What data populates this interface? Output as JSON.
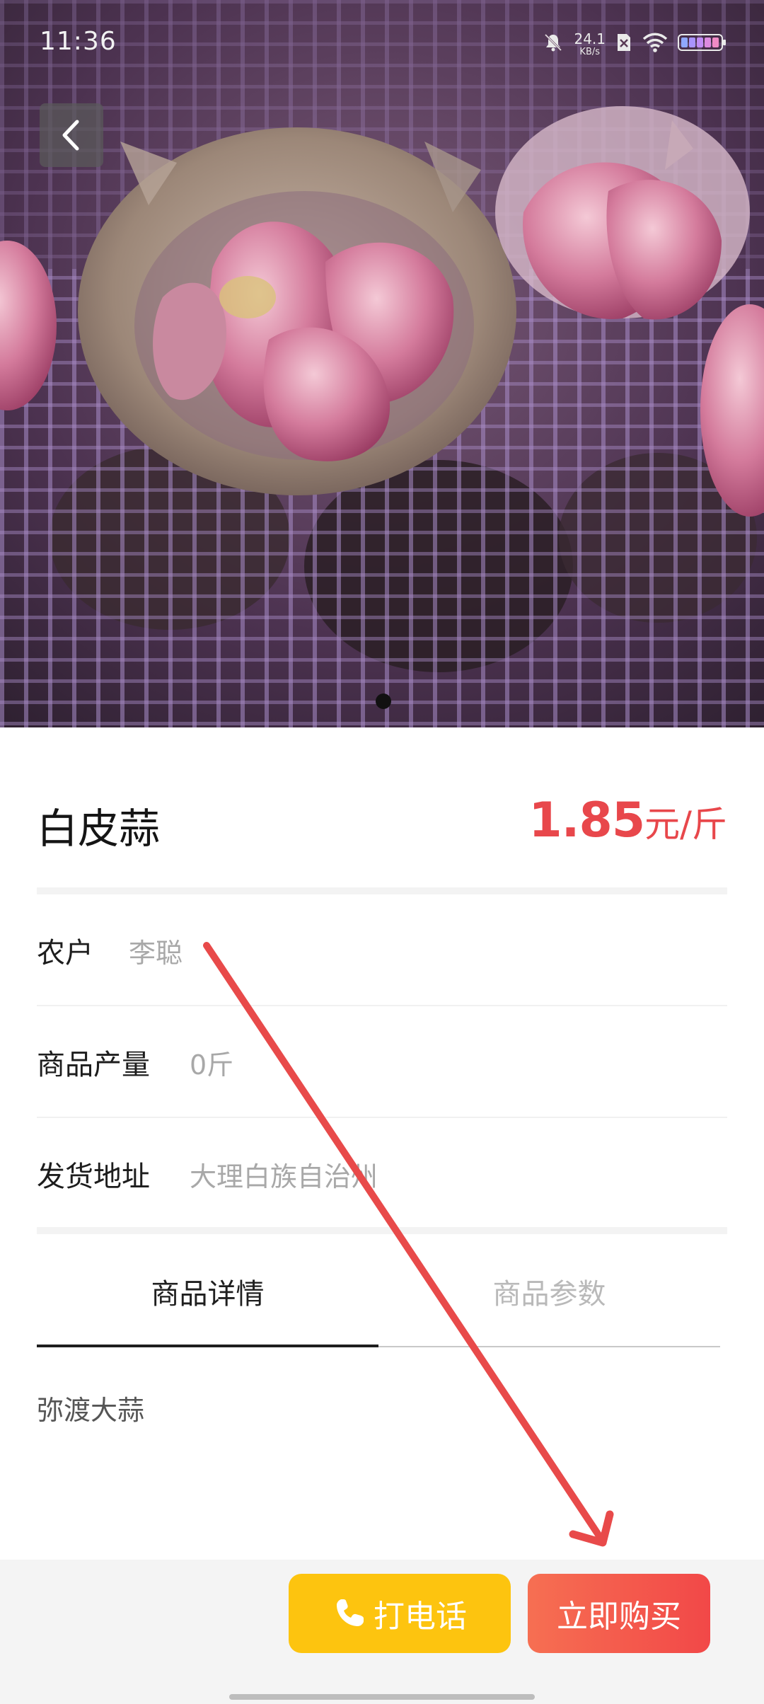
{
  "status_bar": {
    "time": "11:36",
    "net_speed_value": "24.1",
    "net_speed_unit": "KB/s",
    "icons": [
      "mute-bell-icon",
      "sim-off-icon",
      "wifi-icon",
      "battery-icon"
    ]
  },
  "hero": {
    "image_subject": "garlic-photo",
    "carousel_active_index": 1,
    "carousel_total": 1
  },
  "product": {
    "name": "白皮蒜",
    "price_value": "1.85",
    "price_unit": "元/斤"
  },
  "info": {
    "farmer_label": "农户",
    "farmer_value": "李聪",
    "yield_label": "商品产量",
    "yield_value": "0斤",
    "address_label": "发货地址",
    "address_value": "大理白族自治州"
  },
  "tabs": {
    "details_label": "商品详情",
    "params_label": "商品参数",
    "active": "details"
  },
  "details": {
    "text": "弥渡大蒜"
  },
  "actions": {
    "call_label": "打电话",
    "buy_label": "立即购买"
  },
  "colors": {
    "price": "#e8474b",
    "call_button": "#fdc40f",
    "buy_button_start": "#f66f52",
    "buy_button_end": "#f24848",
    "annotation_arrow": "#e84a4a"
  }
}
